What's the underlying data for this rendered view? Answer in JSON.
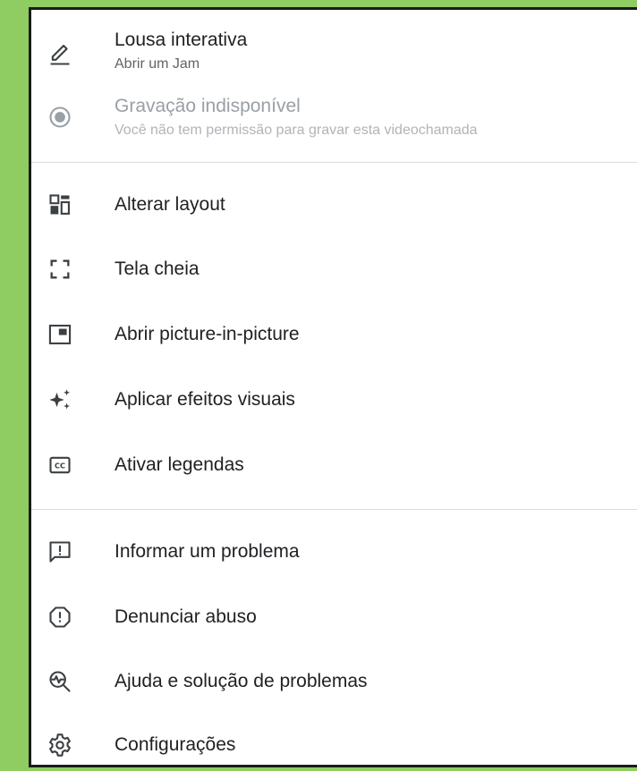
{
  "menu": {
    "items": [
      {
        "label": "Lousa interativa",
        "sublabel": "Abrir um Jam",
        "icon": "pencil-icon",
        "enabled": true
      },
      {
        "label": "Gravação indisponível",
        "sublabel": "Você não tem permissão para gravar esta videochamada",
        "icon": "record-icon",
        "enabled": false
      },
      {
        "label": "Alterar layout",
        "icon": "layout-icon",
        "enabled": true
      },
      {
        "label": "Tela cheia",
        "icon": "fullscreen-icon",
        "enabled": true
      },
      {
        "label": "Abrir picture-in-picture",
        "icon": "picture-in-picture-icon",
        "enabled": true
      },
      {
        "label": "Aplicar efeitos visuais",
        "icon": "sparkle-icon",
        "enabled": true
      },
      {
        "label": "Ativar legendas",
        "icon": "closed-captions-icon",
        "enabled": true
      },
      {
        "label": "Informar um problema",
        "icon": "feedback-icon",
        "enabled": true
      },
      {
        "label": "Denunciar abuso",
        "icon": "report-icon",
        "enabled": true
      },
      {
        "label": "Ajuda e solução de problemas",
        "icon": "help-troubleshoot-icon",
        "enabled": true
      },
      {
        "label": "Configurações",
        "icon": "settings-gear-icon",
        "enabled": true
      }
    ]
  },
  "colors": {
    "background": "#8fcc62",
    "text": "#202124",
    "subtext": "#5f6368",
    "disabled": "#9aa0a6",
    "icon": "#3c4043"
  }
}
